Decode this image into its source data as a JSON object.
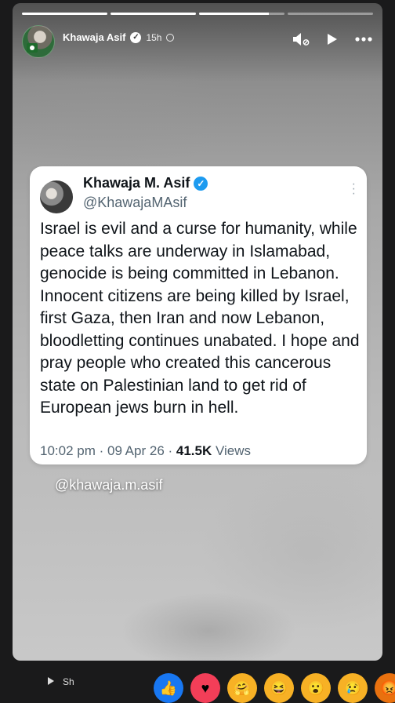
{
  "story": {
    "progress": [
      1,
      1,
      0.82,
      0
    ],
    "author": "Khawaja Asif",
    "time": "15h",
    "icons": {
      "verified": "verified-badge-icon",
      "privacy": "globe-icon",
      "mute": "speaker-muted-icon",
      "play": "play-icon",
      "more": "more-options-icon"
    }
  },
  "tweet": {
    "name": "Khawaja M. Asif",
    "handle": "@KhawajaMAsif",
    "body": "Israel is evil and a curse for humanity, while peace talks are underway in Islamabad, genocide is being committed in Lebanon. Innocent citizens are being killed by Israel, first Gaza, then Iran and now Lebanon, bloodletting continues unabated. I hope and pray people who created this cancerous state on Palestinian land to get rid of European jews burn in hell.",
    "datetime": "10:02 pm · 09 Apr 26 · ",
    "views_count": "41.5K",
    "views_label": " Views"
  },
  "watermark": "@khawaja.m.asif",
  "bottom": {
    "share_label": "Sh",
    "reactions": [
      {
        "name": "like-reaction",
        "color": "#1877f2"
      },
      {
        "name": "love-reaction",
        "color": "#f33e58"
      },
      {
        "name": "care-reaction",
        "color": "#f7b125"
      },
      {
        "name": "haha-reaction",
        "color": "#f7b125"
      },
      {
        "name": "wow-reaction",
        "color": "#f7b125"
      },
      {
        "name": "sad-reaction",
        "color": "#f7b125"
      },
      {
        "name": "angry-reaction",
        "color": "#e9710f"
      }
    ]
  }
}
